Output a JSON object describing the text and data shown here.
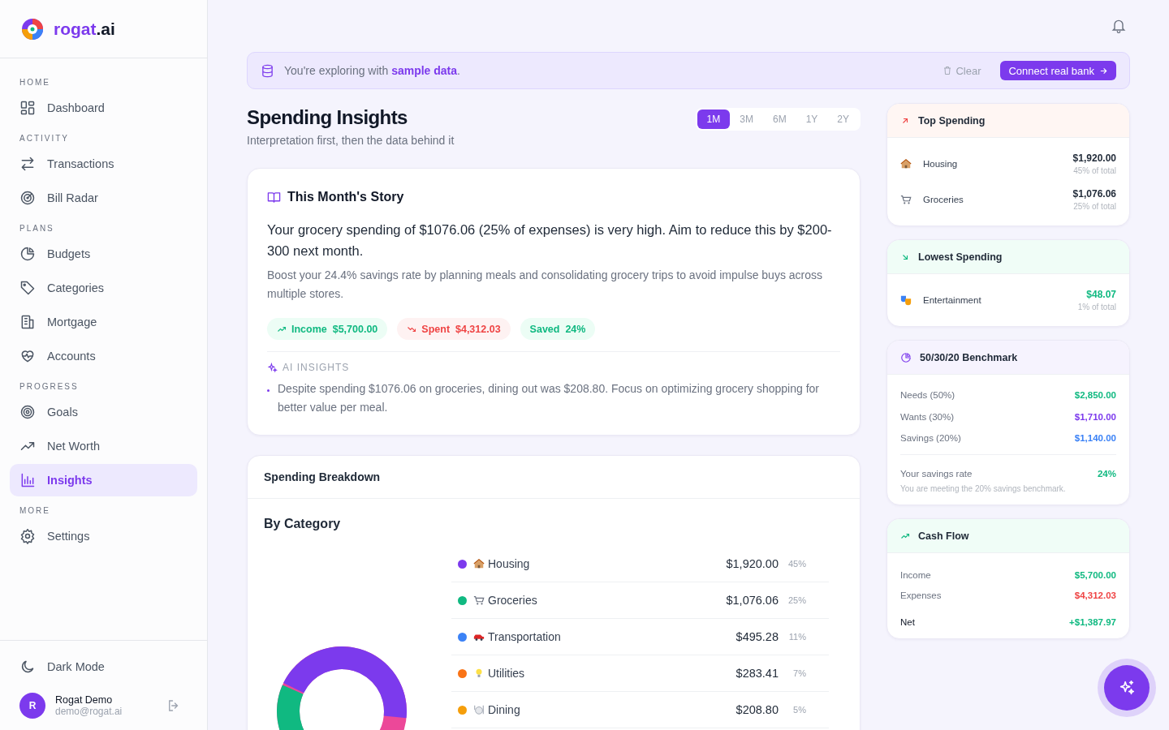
{
  "brand": {
    "name": "rogat",
    "suffix": ".ai"
  },
  "sidebar": {
    "sections": [
      {
        "heading": "HOME",
        "items": [
          {
            "label": "Dashboard",
            "selected": false
          }
        ]
      },
      {
        "heading": "ACTIVITY",
        "items": [
          {
            "label": "Transactions",
            "selected": false
          },
          {
            "label": "Bill Radar",
            "selected": false
          }
        ]
      },
      {
        "heading": "PLANS",
        "items": [
          {
            "label": "Budgets",
            "selected": false
          },
          {
            "label": "Categories",
            "selected": false
          },
          {
            "label": "Mortgage",
            "selected": false
          },
          {
            "label": "Accounts",
            "selected": false
          }
        ]
      },
      {
        "heading": "PROGRESS",
        "items": [
          {
            "label": "Goals",
            "selected": false
          },
          {
            "label": "Net Worth",
            "selected": false
          },
          {
            "label": "Insights",
            "selected": true
          }
        ]
      },
      {
        "heading": "MORE",
        "items": [
          {
            "label": "Settings",
            "selected": false
          }
        ]
      }
    ],
    "dark_mode": "Dark Mode",
    "user": {
      "initial": "R",
      "name": "Rogat Demo",
      "email": "demo@rogat.ai"
    }
  },
  "banner": {
    "text": "You're exploring with **sample data**.",
    "clear": "Clear",
    "button": "Connect real bank"
  },
  "header": {
    "title": "Spending Insights",
    "subtitle": "Interpretation first, then the data behind it",
    "ranges": [
      {
        "label": "1M",
        "selected": true
      },
      {
        "label": "3M",
        "selected": false
      },
      {
        "label": "6M",
        "selected": false
      },
      {
        "label": "1Y",
        "selected": false
      },
      {
        "label": "2Y",
        "selected": false
      }
    ]
  },
  "story": {
    "title": "This Month's Story",
    "headline": "Your grocery spending of $1076.06 (25% of expenses) is very high. Aim to reduce this by $200-300 next month.",
    "body": "Boost your 24.4% savings rate by planning meals and consolidating grocery trips to avoid impulse buys across multiple stores.",
    "pills": [
      {
        "kind": "income",
        "label": "Income",
        "value": "$5,700.00"
      },
      {
        "kind": "spent",
        "label": "Spent",
        "value": "$4,312.03"
      },
      {
        "kind": "saved",
        "label": "Saved",
        "value": "24%"
      }
    ],
    "ai_heading": "AI INSIGHTS",
    "ai_bullets": [
      "Despite spending $1076.06 on groceries, dining out was $208.80. Focus on optimizing grocery shopping for better value per meal."
    ]
  },
  "breakdown": {
    "title": "Spending Breakdown",
    "subtitle": "By Category",
    "categories": [
      {
        "name": "Housing",
        "color": "#7c3aed",
        "amount": "$1,920.00",
        "percent": "45%"
      },
      {
        "name": "Groceries",
        "color": "#10b981",
        "amount": "$1,076.06",
        "percent": "25%"
      },
      {
        "name": "Transportation",
        "color": "#3b82f6",
        "amount": "$495.28",
        "percent": "11%"
      },
      {
        "name": "Utilities",
        "color": "#f97316",
        "amount": "$283.41",
        "percent": "7%"
      },
      {
        "name": "Dining",
        "color": "#f59e0b",
        "amount": "$208.80",
        "percent": "5%"
      }
    ]
  },
  "top_spending": {
    "title": "Top Spending",
    "items": [
      {
        "name": "Housing",
        "amount": "$1,920.00",
        "share": "45% of total"
      },
      {
        "name": "Groceries",
        "amount": "$1,076.06",
        "share": "25% of total"
      }
    ]
  },
  "lowest_spending": {
    "title": "Lowest Spending",
    "items": [
      {
        "name": "Entertainment",
        "amount": "$48.07",
        "share": "1% of total"
      }
    ]
  },
  "benchmark": {
    "title": "50/30/20 Benchmark",
    "rows": [
      {
        "label": "Needs (50%)",
        "value": "$2,850.00",
        "color": "#10b981"
      },
      {
        "label": "Wants (30%)",
        "value": "$1,710.00",
        "color": "#7c3aed"
      },
      {
        "label": "Savings (20%)",
        "value": "$1,140.00",
        "color": "#3b82f6"
      }
    ],
    "rate_label": "Your savings rate",
    "rate_value": "24%",
    "note": "You are meeting the 20% savings benchmark."
  },
  "cash_flow": {
    "title": "Cash Flow",
    "rows": [
      {
        "kind": "income",
        "label": "Income",
        "value": "$5,700.00"
      },
      {
        "kind": "expense",
        "label": "Expenses",
        "value": "$4,312.03"
      },
      {
        "kind": "net",
        "label": "Net",
        "value": "+$1,387.97"
      }
    ]
  }
}
